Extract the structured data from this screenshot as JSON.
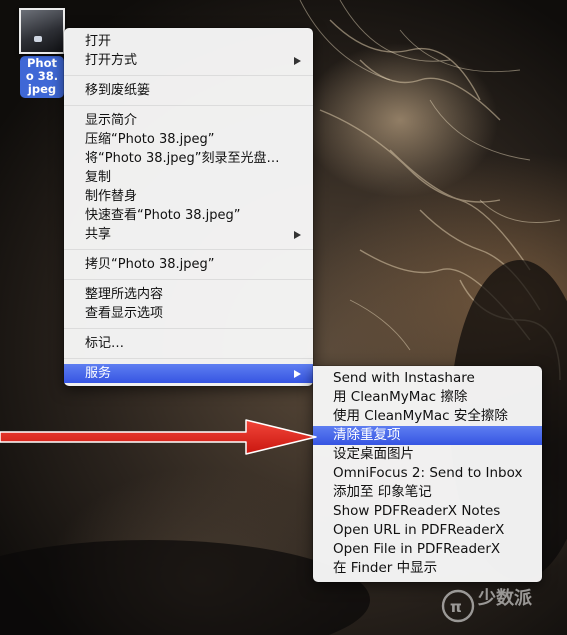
{
  "desktop": {
    "file_label": "Photo 38.jpeg"
  },
  "context_menu": {
    "groups": [
      [
        {
          "label": "打开",
          "submenu": false
        },
        {
          "label": "打开方式",
          "submenu": true
        }
      ],
      [
        {
          "label": "移到废纸篓",
          "submenu": false
        }
      ],
      [
        {
          "label": "显示简介",
          "submenu": false
        },
        {
          "label": "压缩“Photo 38.jpeg”",
          "submenu": false
        },
        {
          "label": "将“Photo 38.jpeg”刻录至光盘…",
          "submenu": false
        },
        {
          "label": "复制",
          "submenu": false
        },
        {
          "label": "制作替身",
          "submenu": false
        },
        {
          "label": "快速查看“Photo 38.jpeg”",
          "submenu": false
        },
        {
          "label": "共享",
          "submenu": true
        }
      ],
      [
        {
          "label": "拷贝“Photo 38.jpeg”",
          "submenu": false
        }
      ],
      [
        {
          "label": "整理所选内容",
          "submenu": false
        },
        {
          "label": "查看显示选项",
          "submenu": false
        }
      ],
      [
        {
          "label": "标记…",
          "submenu": false
        }
      ],
      [
        {
          "label": "服务",
          "submenu": true,
          "highlighted": true
        }
      ]
    ]
  },
  "services_submenu": {
    "items": [
      {
        "label": "Send with Instashare"
      },
      {
        "label": "用 CleanMyMac 擦除"
      },
      {
        "label": "使用 CleanMyMac 安全擦除"
      },
      {
        "label": "清除重复项",
        "highlighted": true
      },
      {
        "label": "设定桌面图片"
      },
      {
        "label": "OmniFocus 2: Send to Inbox"
      },
      {
        "label": "添加至 印象笔记"
      },
      {
        "label": "Show PDFReaderX Notes"
      },
      {
        "label": "Open URL in PDFReaderX"
      },
      {
        "label": "Open File in PDFReaderX"
      },
      {
        "label": "在 Finder 中显示"
      }
    ]
  },
  "colors": {
    "highlight": "#3f63e6",
    "arrow": "#e5261f",
    "label_bg": "#3f68d6"
  },
  "icons": {
    "submenu_indicator": "chevron-right-icon",
    "annotation": "red-arrow-icon",
    "watermark": "site-watermark-logo"
  },
  "watermark": {
    "text": "少数派"
  }
}
